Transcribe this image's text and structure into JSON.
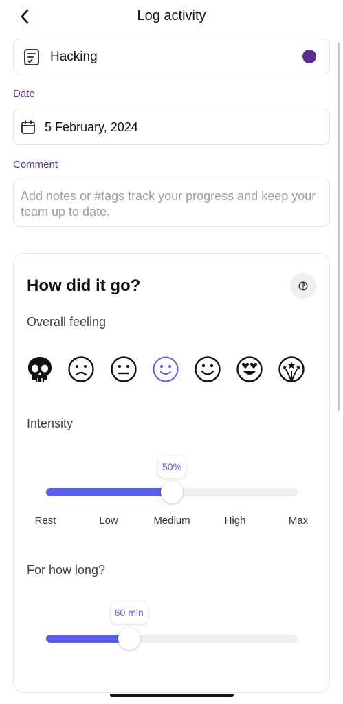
{
  "header": {
    "title": "Log activity"
  },
  "activity": {
    "name": "Hacking",
    "color": "#5b2e91"
  },
  "date": {
    "label": "Date",
    "value": "5 February, 2024"
  },
  "comment": {
    "label": "Comment",
    "placeholder": "Add notes or #tags track your progress and keep your team up to date."
  },
  "card": {
    "title": "How did it go?",
    "feeling": {
      "label": "Overall feeling",
      "options": [
        "skull",
        "frown",
        "neutral",
        "smile",
        "happy",
        "heart-eyes",
        "fireworks"
      ],
      "selected": "smile",
      "selected_color": "#5a5ef0"
    },
    "intensity": {
      "label": "Intensity",
      "value_label": "50%",
      "value": 0.5,
      "ticks": [
        "Rest",
        "Low",
        "Medium",
        "High",
        "Max"
      ]
    },
    "duration": {
      "label": "For how long?",
      "value_label": "60 min",
      "value": 0.33
    }
  },
  "accent": "#5a5ef0"
}
